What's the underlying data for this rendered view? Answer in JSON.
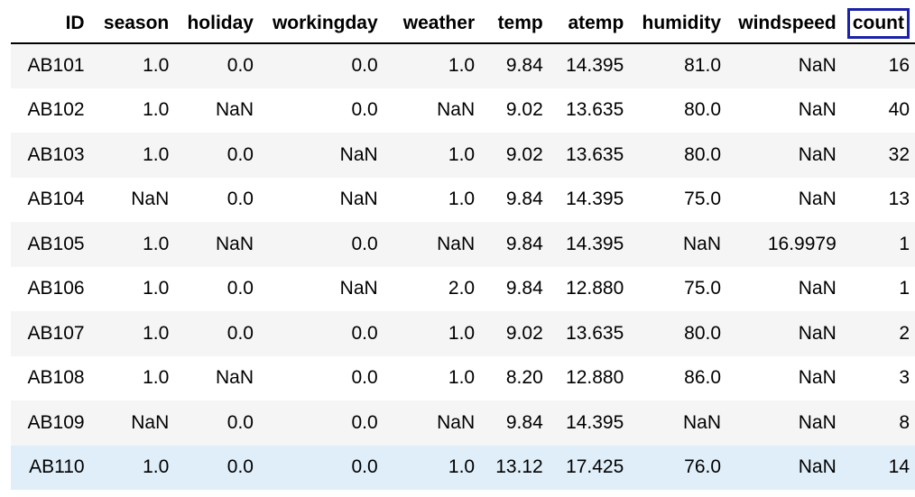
{
  "table": {
    "highlight_column": "count",
    "highlight_color": "#1a22a8",
    "highlight_row_bg": "#dfeef9",
    "columns": [
      "ID",
      "season",
      "holiday",
      "workingday",
      "weather",
      "temp",
      "atemp",
      "humidity",
      "windspeed",
      "count"
    ],
    "rows": [
      [
        "AB101",
        "1.0",
        "0.0",
        "0.0",
        "1.0",
        "9.84",
        "14.395",
        "81.0",
        "NaN",
        "16"
      ],
      [
        "AB102",
        "1.0",
        "NaN",
        "0.0",
        "NaN",
        "9.02",
        "13.635",
        "80.0",
        "NaN",
        "40"
      ],
      [
        "AB103",
        "1.0",
        "0.0",
        "NaN",
        "1.0",
        "9.02",
        "13.635",
        "80.0",
        "NaN",
        "32"
      ],
      [
        "AB104",
        "NaN",
        "0.0",
        "NaN",
        "1.0",
        "9.84",
        "14.395",
        "75.0",
        "NaN",
        "13"
      ],
      [
        "AB105",
        "1.0",
        "NaN",
        "0.0",
        "NaN",
        "9.84",
        "14.395",
        "NaN",
        "16.9979",
        "1"
      ],
      [
        "AB106",
        "1.0",
        "0.0",
        "NaN",
        "2.0",
        "9.84",
        "12.880",
        "75.0",
        "NaN",
        "1"
      ],
      [
        "AB107",
        "1.0",
        "0.0",
        "0.0",
        "1.0",
        "9.02",
        "13.635",
        "80.0",
        "NaN",
        "2"
      ],
      [
        "AB108",
        "1.0",
        "NaN",
        "0.0",
        "1.0",
        "8.20",
        "12.880",
        "86.0",
        "NaN",
        "3"
      ],
      [
        "AB109",
        "NaN",
        "0.0",
        "0.0",
        "NaN",
        "9.84",
        "14.395",
        "NaN",
        "NaN",
        "8"
      ],
      [
        "AB110",
        "1.0",
        "0.0",
        "0.0",
        "1.0",
        "13.12",
        "17.425",
        "76.0",
        "NaN",
        "14"
      ]
    ],
    "highlighted_row_index": 9
  }
}
